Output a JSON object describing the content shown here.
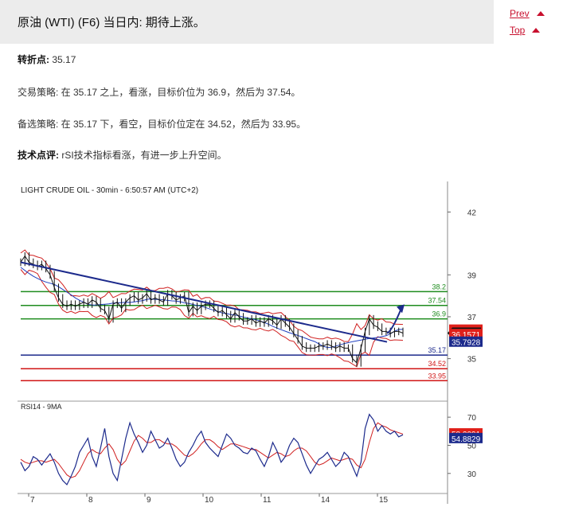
{
  "header": {
    "title": "原油 (WTI) (F6) 当日内: 期待上涨。"
  },
  "nav": {
    "prev_label": "Prev",
    "top_label": "Top"
  },
  "analysis": {
    "pivot_label": "转折点:",
    "pivot_value": " 35.17",
    "strategy_label": "交易策略:",
    "strategy_text": " 在 35.17 之上，看涨，目标价位为 36.9，然后为 37.54。",
    "alt_label": "备选策略:",
    "alt_text": " 在 35.17 下，看空，目标价位定在 34.52，然后为 33.95。",
    "comment_label": "技术点评:",
    "comment_text": " rSI技术指标看涨，有进一步上升空间。"
  },
  "chart_data": {
    "type": "line",
    "title": "LIGHT CRUDE OIL - 30min - 6:50:57 AM (UTC+2)",
    "x_tick_labels": [
      "7",
      "8",
      "9",
      "10",
      "11",
      "14",
      "15"
    ],
    "price_axis": {
      "ylim": [
        33.2,
        43
      ],
      "ticks": [
        42,
        39,
        37,
        35
      ]
    },
    "levels": [
      {
        "value": 38.2,
        "label": "38.2",
        "color": "#1e8c1e"
      },
      {
        "value": 37.54,
        "label": "37.54",
        "color": "#1e8c1e"
      },
      {
        "value": 36.9,
        "label": "36.9",
        "color": "#1e8c1e"
      },
      {
        "value": 35.17,
        "label": "35.17",
        "color": "#1c2a8c"
      },
      {
        "value": 34.52,
        "label": "34.52",
        "color": "#d01515"
      },
      {
        "value": 33.95,
        "label": "33.95",
        "color": "#d01515"
      }
    ],
    "badges": [
      {
        "value": 36.3669,
        "label": "36.3669",
        "color": "#e0201a"
      },
      {
        "value": 36.266,
        "label": "36.266",
        "color": "#e0201a"
      },
      {
        "value": 36.22,
        "label": "36.22",
        "color": "#111111"
      },
      {
        "value": 36.1571,
        "label": "36.1571",
        "color": "#e0201a"
      },
      {
        "value": 35.7928,
        "label": "35.7928",
        "color": "#1c2a8c"
      }
    ],
    "price_series": [
      39.6,
      39.9,
      39.6,
      39.5,
      39.4,
      39.5,
      39.3,
      39.0,
      38.4,
      37.9,
      37.6,
      37.5,
      37.6,
      37.5,
      37.6,
      37.7,
      37.6,
      37.8,
      37.7,
      37.4,
      37.3,
      36.9,
      37.6,
      37.7,
      37.4,
      37.7,
      37.9,
      38.0,
      37.8,
      37.9,
      38.1,
      37.8,
      37.9,
      37.8,
      37.7,
      38.1,
      38.0,
      37.8,
      37.9,
      38.0,
      37.2,
      37.5,
      37.3,
      37.5,
      37.6,
      37.6,
      37.4,
      37.2,
      37.3,
      37.1,
      36.9,
      37.2,
      37.0,
      36.8,
      36.8,
      36.9,
      36.7,
      36.8,
      36.7,
      36.9,
      36.8,
      36.6,
      36.9,
      36.7,
      36.5,
      36.2,
      35.9,
      35.6,
      35.5,
      35.5,
      35.5,
      35.6,
      35.6,
      35.7,
      35.6,
      35.5,
      35.6,
      35.5,
      35.5,
      35.0,
      34.8,
      35.5,
      36.3,
      36.9,
      36.6,
      36.5,
      36.3,
      36.3,
      36.2,
      36.3,
      36.3,
      36.22
    ],
    "trendline": {
      "x": [
        0,
        460
      ],
      "y": [
        39.6,
        35.8
      ]
    },
    "forecast_arrow": {
      "x": [
        460,
        478
      ],
      "y": [
        36.22,
        37.4
      ]
    },
    "rsi": {
      "label": "RSI14 - 9MA",
      "ylim": [
        18,
        78
      ],
      "ticks": [
        70,
        50,
        30
      ],
      "badges": [
        {
          "value": 58.2091,
          "label": "58.2091",
          "color": "#e0201a"
        },
        {
          "value": 54.8829,
          "label": "54.8829",
          "color": "#1c2a8c"
        }
      ],
      "series": [
        38,
        32,
        35,
        42,
        40,
        36,
        40,
        44,
        38,
        30,
        25,
        22,
        28,
        35,
        45,
        50,
        55,
        42,
        35,
        48,
        62,
        42,
        30,
        25,
        40,
        55,
        66,
        58,
        52,
        45,
        50,
        60,
        54,
        48,
        50,
        55,
        48,
        40,
        35,
        38,
        45,
        50,
        56,
        60,
        52,
        48,
        45,
        42,
        50,
        58,
        55,
        50,
        48,
        45,
        44,
        48,
        46,
        40,
        35,
        42,
        52,
        46,
        38,
        42,
        50,
        55,
        52,
        44,
        36,
        30,
        35,
        40,
        42,
        45,
        40,
        35,
        38,
        45,
        42,
        35,
        28,
        38,
        62,
        72,
        68,
        60,
        64,
        60,
        58,
        60,
        56,
        57.5
      ],
      "ma": [
        40,
        38,
        37,
        38,
        39,
        39,
        38,
        39,
        40,
        37,
        33,
        29,
        27,
        28,
        32,
        38,
        44,
        47,
        45,
        44,
        48,
        51,
        47,
        40,
        36,
        39,
        46,
        53,
        57,
        55,
        52,
        52,
        54,
        54,
        52,
        51,
        51,
        49,
        46,
        43,
        42,
        44,
        47,
        51,
        54,
        54,
        52,
        49,
        47,
        49,
        51,
        51,
        50,
        49,
        48,
        47,
        47,
        45,
        43,
        41,
        43,
        45,
        44,
        42,
        43,
        46,
        48,
        48,
        46,
        42,
        38,
        36,
        37,
        39,
        41,
        40,
        39,
        40,
        41,
        40,
        36,
        34,
        40,
        52,
        62,
        66,
        64,
        63,
        61,
        60,
        59,
        58
      ]
    }
  }
}
